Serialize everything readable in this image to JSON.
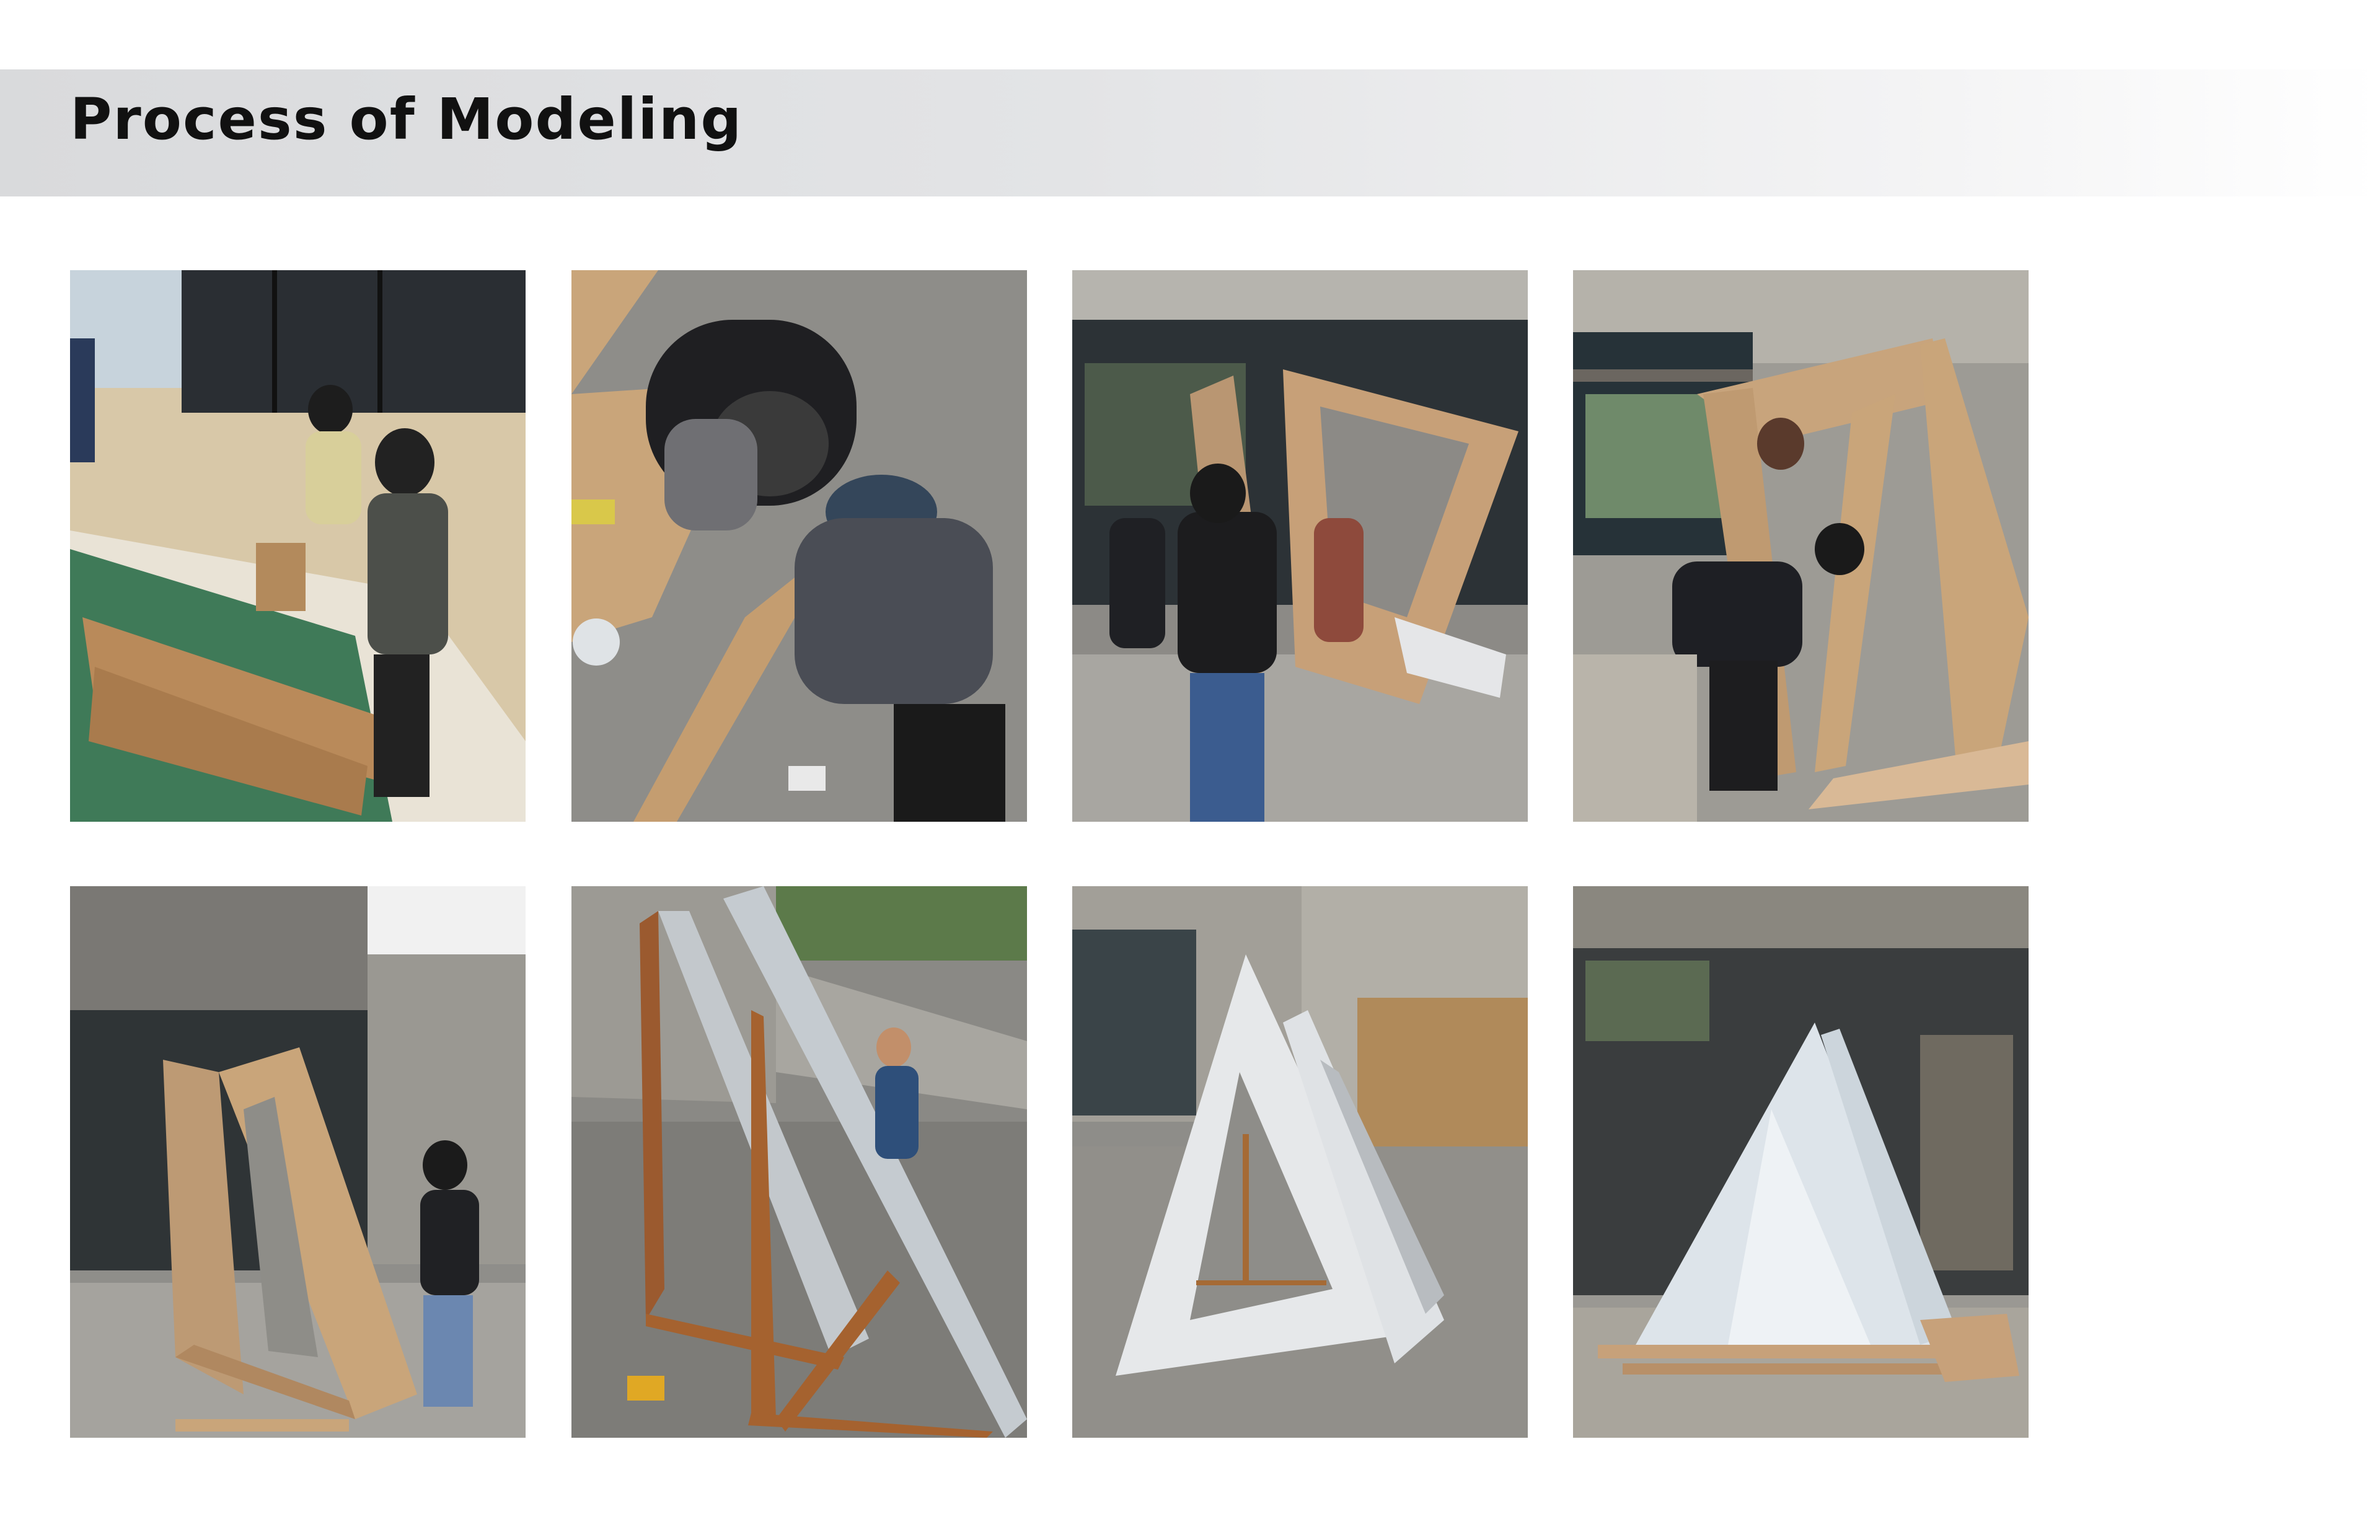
{
  "page": {
    "title": "Process of Modeling"
  },
  "photos": [
    {
      "icon": "workshop-cardboard-cutting-photo"
    },
    {
      "icon": "cutting-cardboard-on-floor-photo"
    },
    {
      "icon": "assembling-cardboard-frame-photo"
    },
    {
      "icon": "standing-cardboard-frame-photo"
    },
    {
      "icon": "cardboard-mockup-with-person-photo"
    },
    {
      "icon": "wooden-frame-structure-photo"
    },
    {
      "icon": "white-triangular-frames-photo"
    },
    {
      "icon": "plastic-wrapped-pavilion-photo"
    }
  ],
  "colors": {
    "header_band": "#dcdde0",
    "title_text": "#111111",
    "cardboard": "#c9a27a",
    "concrete": "#8d8c88"
  }
}
